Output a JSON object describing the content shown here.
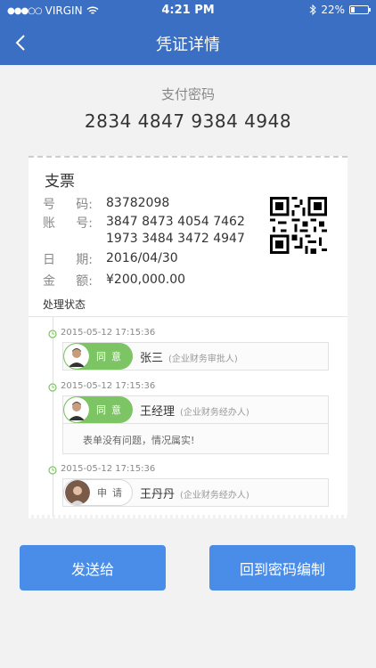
{
  "status_bar": {
    "carrier": "VIRGIN",
    "time": "4:21 PM",
    "battery": "22%"
  },
  "nav": {
    "title": "凭证详情"
  },
  "password": {
    "label": "支付密码",
    "value": "2834 4847 9384 4948"
  },
  "voucher": {
    "title": "支票",
    "number_label": [
      "号",
      "码:"
    ],
    "number": "83782098",
    "account_label": [
      "账",
      "号:"
    ],
    "account_line1": "3847 8473 4054 7462",
    "account_line2": "1973 3484 3472 4947",
    "date_label": [
      "日",
      "期:"
    ],
    "date": "2016/04/30",
    "amount_label": [
      "金",
      "额:"
    ],
    "amount": "¥200,000.00"
  },
  "process": {
    "title": "处理状态",
    "entries": [
      {
        "time": "2015-05-12  17:15:36",
        "action": "同意",
        "name": "张三",
        "role": "(企业财务审批人)"
      },
      {
        "time": "2015-05-12  17:15:36",
        "action": "同意",
        "name": "王经理",
        "role": "(企业财务经办人)",
        "comment": "表单没有问题，情况属实!"
      },
      {
        "time": "2015-05-12  17:15:36",
        "action": "申请",
        "name": "王丹丹",
        "role": "(企业财务经办人)"
      }
    ]
  },
  "actions": {
    "send": "发送给",
    "back": "回到密码编制"
  },
  "colors": {
    "header": "#3b6fc3",
    "button": "#4a8de8",
    "approve": "#7cc464"
  }
}
